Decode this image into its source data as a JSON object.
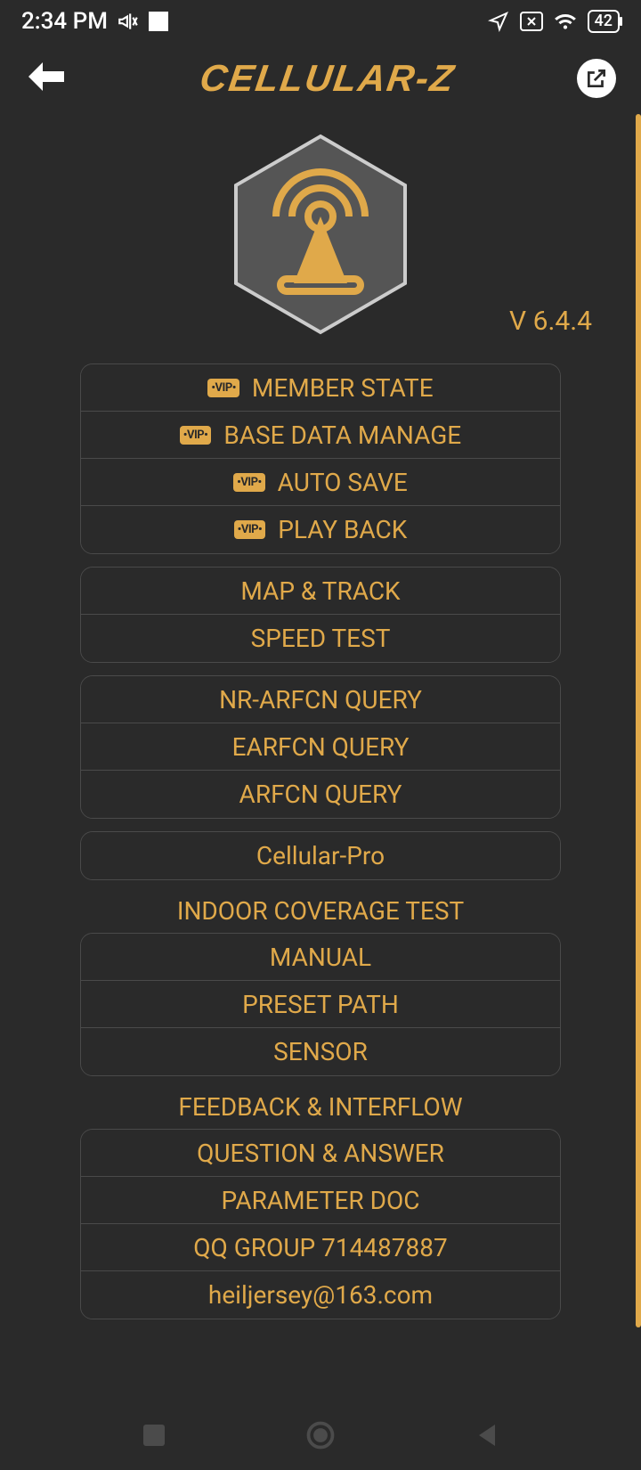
{
  "status": {
    "time": "2:34 PM",
    "battery": "42"
  },
  "header": {
    "title": "Cellular-Z"
  },
  "version": "V 6.4.4",
  "vip_label": "•VIP•",
  "groups": {
    "member": {
      "items": [
        {
          "label": "MEMBER STATE",
          "vip": true
        },
        {
          "label": "BASE DATA MANAGE",
          "vip": true
        },
        {
          "label": "AUTO SAVE",
          "vip": true
        },
        {
          "label": "PLAY BACK",
          "vip": true
        }
      ]
    },
    "tools": {
      "items": [
        {
          "label": "MAP & TRACK"
        },
        {
          "label": "SPEED TEST"
        }
      ]
    },
    "query": {
      "items": [
        {
          "label": "NR-ARFCN QUERY"
        },
        {
          "label": "EARFCN QUERY"
        },
        {
          "label": "ARFCN QUERY"
        }
      ]
    },
    "pro": {
      "items": [
        {
          "label": "Cellular-Pro"
        }
      ]
    },
    "indoor": {
      "title": "INDOOR COVERAGE TEST",
      "items": [
        {
          "label": "MANUAL"
        },
        {
          "label": "PRESET PATH"
        },
        {
          "label": "SENSOR"
        }
      ]
    },
    "feedback": {
      "title": "FEEDBACK & INTERFLOW",
      "items": [
        {
          "label": "QUESTION & ANSWER"
        },
        {
          "label": "PARAMETER DOC"
        },
        {
          "label": "QQ GROUP 714487887"
        },
        {
          "label": "heiljersey@163.com"
        }
      ]
    }
  }
}
